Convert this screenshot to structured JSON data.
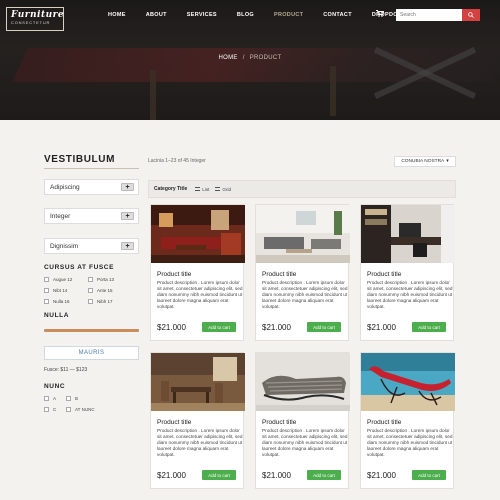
{
  "brand": {
    "name": "Furniture",
    "tagline": "CONSECTETUR"
  },
  "nav": {
    "items": [
      {
        "label": "HOME",
        "active": false
      },
      {
        "label": "ABOUT",
        "active": false
      },
      {
        "label": "SERVICES",
        "active": false
      },
      {
        "label": "BLOG",
        "active": false
      },
      {
        "label": "PRODUCT",
        "active": true
      },
      {
        "label": "CONTACT",
        "active": false
      },
      {
        "label": "DROPDOWN",
        "active": false,
        "has_caret": true
      }
    ],
    "cart_icon": "cart-icon"
  },
  "search": {
    "placeholder": "Search",
    "button_icon": "search-icon"
  },
  "breadcrumb": {
    "home": "HOME",
    "current": "PRODUCT",
    "separator": "/"
  },
  "sidebar": {
    "title": "VESTIBULUM",
    "accordions": [
      {
        "label": "Adipiscing"
      },
      {
        "label": "Integer"
      },
      {
        "label": "Dignissim"
      }
    ],
    "cursus": {
      "title": "CURSUS AT FUSCE",
      "options": [
        "Augue 12",
        "Porta 13",
        "Nibt 14",
        "Ante 15",
        "Nulla 16",
        "Nibh 17"
      ]
    },
    "nulla": {
      "title": "NULLA"
    },
    "mauris_button": "MAURIS",
    "price_text": "Fusce: $11 — $123",
    "nunc": {
      "title": "NUNC",
      "options": [
        "A",
        "B",
        "C",
        "AT NUNC"
      ]
    }
  },
  "main": {
    "result_count": "Lacinia 1–23 of 45 Integer",
    "sort_label": "CONUBIA NOSTRA",
    "filter": {
      "category_title": "Category Title",
      "list_label": "List",
      "grid_label": "Grid"
    },
    "products": [
      {
        "title": "Product title",
        "description": "Product description . Lorem ipsum dolor sit amet, consectetuer adipiscing elit, sed diam nonummy nibh euismod tincidunt ut laoreet dolore magna aliquam erat volutpat.",
        "price": "$21.000",
        "button": "Add to cart",
        "image": "red-dining-room"
      },
      {
        "title": "Product title",
        "description": "Product description . Lorem ipsum dolor sit amet, consectetuer adipiscing elit, sed diam nonummy nibh euismod tincidunt ut laoreet dolore magna aliquam erat volutpat.",
        "price": "$21.000",
        "button": "Add to cart",
        "image": "grey-living-room"
      },
      {
        "title": "Product title",
        "description": "Product description . Lorem ipsum dolor sit amet, consectetuer adipiscing elit, sed diam nonummy nibh euismod tincidunt ut laoreet dolore magna aliquam erat volutpat.",
        "price": "$21.000",
        "button": "Add to cart",
        "image": "office-desk"
      },
      {
        "title": "Product title",
        "description": "Product description . Lorem ipsum dolor sit amet, consectetuer adipiscing elit, sed diam nonummy nibh euismod tincidunt ut laoreet dolore magna aliquam erat volutpat.",
        "price": "$21.000",
        "button": "Add to cart",
        "image": "wooden-dining-room"
      },
      {
        "title": "Product title",
        "description": "Product description . Lorem ipsum dolor sit amet, consectetuer adipiscing elit, sed diam nonummy nibh euismod tincidunt ut laoreet dolore magna aliquam erat volutpat.",
        "price": "$21.000",
        "button": "Add to cart",
        "image": "striped-chaise-longue"
      },
      {
        "title": "Product title",
        "description": "Product description . Lorem ipsum dolor sit amet, consectetuer adipiscing elit, sed diam nonummy nibh euismod tincidunt ut laoreet dolore magna aliquam erat volutpat.",
        "price": "$21.000",
        "button": "Add to cart",
        "image": "red-lounge-chair"
      }
    ]
  },
  "colors": {
    "accent_red": "#d44141",
    "add_green": "#4cae4c",
    "range_bar": "#c98c5c",
    "active_nav": "#b7a98f"
  }
}
